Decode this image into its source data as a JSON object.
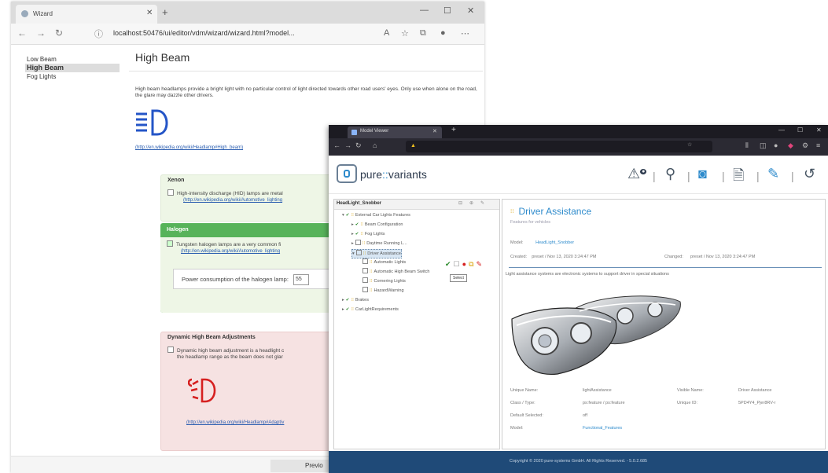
{
  "wizard_window": {
    "tab_title": "Wizard",
    "url": "localhost:50476/ui/editor/vdm/wizard/wizard.html?model...",
    "sidebar": [
      {
        "label": "Low Beam",
        "selected": false
      },
      {
        "label": "High Beam",
        "selected": true
      },
      {
        "label": "Fog Lights",
        "selected": false
      }
    ],
    "page_title": "High Beam",
    "description": "High beam headlamps provide a bright light with no particular control of light directed towards other road users' eyes. Only use when alone on the road, the glare may dazzle other drivers.",
    "main_link": "(http://en.wikipedia.org/wiki/Headlamp#High_beam)",
    "xenon": {
      "title": "Xenon",
      "text": "High-intensity discharge (HID) lamps are metal",
      "link": "(http://en.wikipedia.org/wiki/Automotive_lighting"
    },
    "halogen": {
      "title": "Halogen",
      "text": "Tungsten halogen lamps are a very common fi",
      "link": "(http://en.wikipedia.org/wiki/Automotive_lighting",
      "power_label": "Power consumption of the halogen lamp:",
      "power_value": "55"
    },
    "dynamic": {
      "title": "Dynamic High Beam Adjustments",
      "text1": "Dynamic high beam adjustment is a headlight c",
      "text2": "the headlamp range as the beam does not glar",
      "link": "(http://en.wikipedia.org/wiki/Headlamp#Adaptiv"
    },
    "previous_button": "Previo",
    "colors": {
      "xenon_bg": "#eef6e6",
      "halogen_bg": "#57b35a",
      "dynamic_bg": "#f6e2e2",
      "icon_blue": "#2455c7",
      "icon_red": "#d62020"
    }
  },
  "model_window": {
    "tab_title": "Model Viewer",
    "brand": {
      "left": "pure",
      "sep": "::",
      "right": "variants"
    },
    "tree": {
      "header": "HeadLight_Snobber",
      "nodes": [
        {
          "label": "External Car Lights Features",
          "level": 1
        },
        {
          "label": "Beam Configuration",
          "level": 2
        },
        {
          "label": "Fog Lights",
          "level": 2
        },
        {
          "label": "Daytime Running L...",
          "level": 2
        },
        {
          "label": "Driver Assistance",
          "level": 2
        },
        {
          "label": "Automatic Lights",
          "level": 3
        },
        {
          "label": "Automatic High Beam Switch",
          "level": 3
        },
        {
          "label": "Cornering Lights",
          "level": 3
        },
        {
          "label": "HazardWarning",
          "level": 3
        },
        {
          "label": "Brakes",
          "level": 1
        },
        {
          "label": "CarLightRequirements",
          "level": 1
        }
      ],
      "tooltip": "Select"
    },
    "detail": {
      "title": "Driver Assistance",
      "subtitle": "Features for vehicles",
      "model_label": "Model:",
      "model_value": "HeadLight_Snobber",
      "created_label": "Created:",
      "created_value": "preset / Nov 13, 2020 3:24:47 PM",
      "changed_label": "Changed:",
      "changed_value": "preset / Nov 13, 2020 3:24:47 PM",
      "description": "Light assistance systems are electronic systems to support driver in special situations",
      "props": [
        {
          "k": "Unique Name:",
          "v": "lightAssistance",
          "k2": "Visible Name:",
          "v2": "Driver Assistance"
        },
        {
          "k": "Class / Type:",
          "v": "ps:feature / ps:feature",
          "k2": "Unique ID:",
          "v2": "5PD4Y4_Pjer8RV-r"
        },
        {
          "k": "Default Selected:",
          "v": "off",
          "k2": "",
          "v2": ""
        },
        {
          "k": "Model:",
          "v": "Functional_Features",
          "k2": "",
          "v2": ""
        }
      ]
    },
    "footer": "Copyright © 2020 pure-systems GmbH. All Rights Reserved. - 5.0.2.685"
  }
}
